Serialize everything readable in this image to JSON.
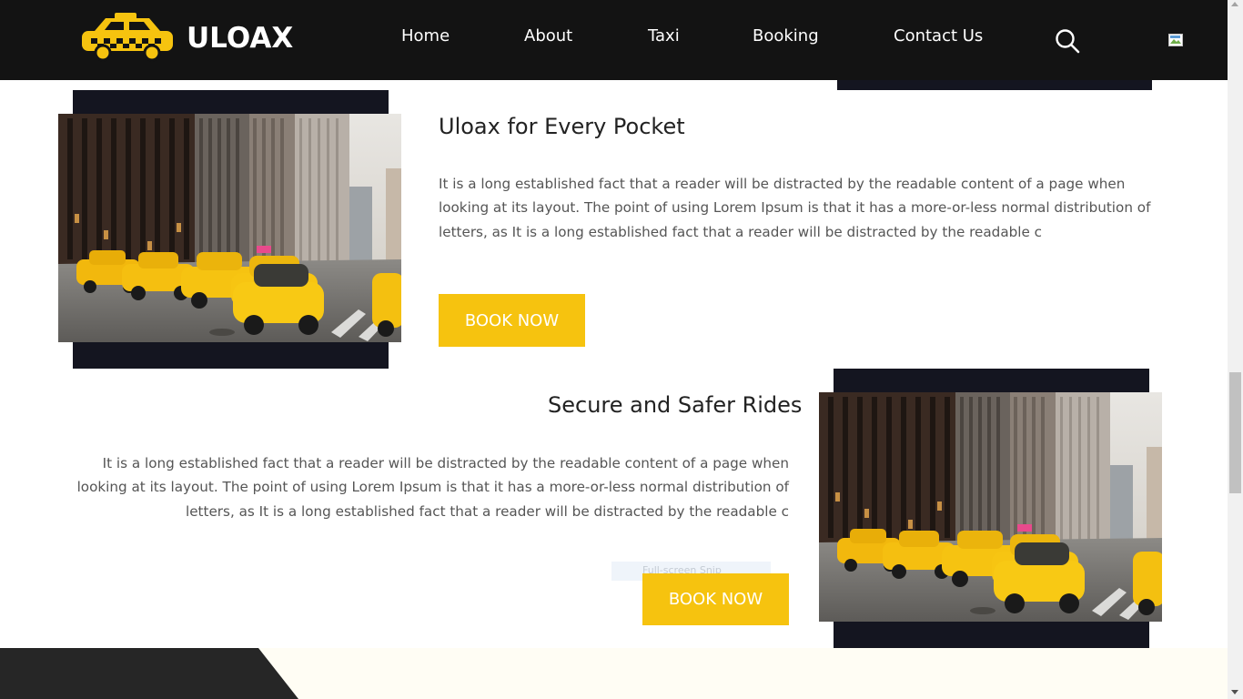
{
  "header": {
    "brand": "ULOAX",
    "nav": [
      {
        "label": "Home"
      },
      {
        "label": "About"
      },
      {
        "label": "Taxi"
      },
      {
        "label": "Booking"
      },
      {
        "label": "Contact Us"
      }
    ],
    "search_icon": "search-icon"
  },
  "sections": [
    {
      "title": "Uloax for Every Pocket",
      "text": "It is a long established fact that a reader will be distracted by the readable content of a page when looking at its layout. The point of using Lorem Ipsum is that it has a more-or-less normal distribution of letters, as It is a long established fact that a reader will be distracted by the readable c",
      "button": "BOOK NOW"
    },
    {
      "title": "Secure and Safer Rides",
      "text": "It is a long established fact that a reader will be distracted by the readable content of a page when looking at its layout. The point of using Lorem Ipsum is that it has a more-or-less normal distribution of letters, as It is a long established fact that a reader will be distracted by the readable c",
      "button": "BOOK NOW"
    }
  ],
  "overlay": {
    "snip_label": "Full-screen Snip"
  },
  "colors": {
    "header_bg": "#131313",
    "accent": "#f6c30f",
    "frame_dark": "#141520",
    "footer_light": "#fffdf4"
  }
}
